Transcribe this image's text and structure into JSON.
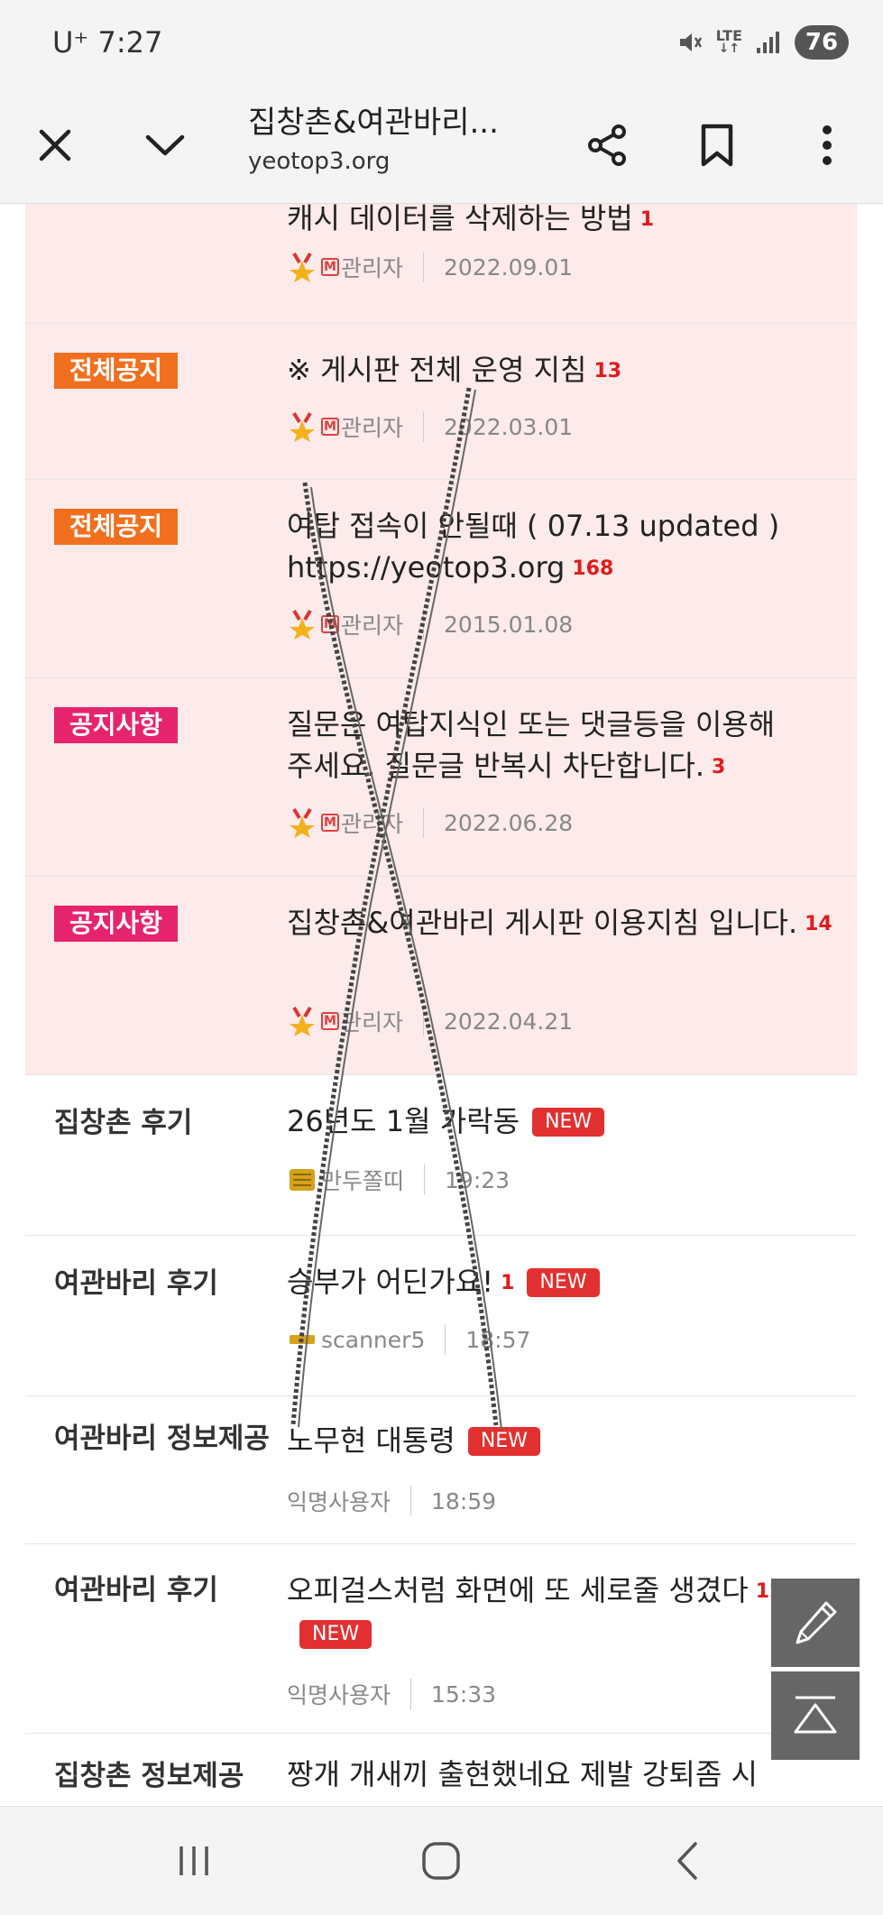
{
  "status_bar": {
    "carrier_time": "U⁺ 7:27",
    "network": "LTE",
    "battery": "76"
  },
  "toolbar": {
    "title": "집창촌&여관바리...",
    "url": "yeotop3.org"
  },
  "posts": [
    {
      "type": "notice",
      "badge": "",
      "title": "캐시 데이터를 삭제하는 방법",
      "comments": "1",
      "author": "관리자",
      "date": "2022.09.01"
    },
    {
      "type": "notice",
      "badge": "전체공지",
      "badge_color": "#f07020",
      "title": "※ 게시판 전체 운영 지침",
      "comments": "13",
      "author": "관리자",
      "date": "2022.03.01"
    },
    {
      "type": "notice",
      "badge": "전체공지",
      "badge_color": "#f07020",
      "title": "여탑 접속이 안될때 ( 07.13 updated ) https://yeotop3.org",
      "comments": "168",
      "author": "관리자",
      "date": "2015.01.08"
    },
    {
      "type": "notice",
      "badge": "공지사항",
      "badge_color": "#e6246d",
      "title": "질문은 여탑지식인 또는 댓글등을 이용해 주세요. 질문글 반복시 차단합니다.",
      "comments": "3",
      "author": "관리자",
      "date": "2022.06.28"
    },
    {
      "type": "notice",
      "badge": "공지사항",
      "badge_color": "#e6246d",
      "title": "집창촌&여관바리 게시판 이용지침 입니다.",
      "comments": "14",
      "author": "관리자",
      "date": "2022.04.21"
    },
    {
      "type": "post",
      "category": "집창촌 후기",
      "title": "26년도 1월 가락동",
      "comments": "",
      "new_label": "NEW",
      "author": "만두쫄띠",
      "time": "19:23"
    },
    {
      "type": "post",
      "category": "여관바리 후기",
      "title": "승부가 어딘가요!",
      "comments": "1",
      "new_label": "NEW",
      "author": "scanner5",
      "time": "18:57"
    },
    {
      "type": "post",
      "category": "여관바리 정보제공",
      "title": "노무현 대통령",
      "comments": "",
      "new_label": "NEW",
      "author": "익명사용자",
      "time": "18:59"
    },
    {
      "type": "post",
      "category": "여관바리 후기",
      "title": "오피걸스처럼 화면에 또 세로줄 생겼다",
      "comments": "12",
      "new_label": "NEW",
      "author": "익명사용자",
      "time": "15:33"
    },
    {
      "type": "post",
      "category": "집창촌 정보제공",
      "title": "짱개 개새끼 출현했네요 제발 강퇴좀 시",
      "comments": "",
      "new_label": "",
      "author": "",
      "time": ""
    }
  ],
  "icons": {
    "close": "close-icon",
    "chevron": "chevron-down-icon",
    "share": "share-icon",
    "bookmark": "bookmark-icon",
    "more": "more-vert-icon",
    "write": "pencil-icon",
    "top": "scroll-top-icon"
  },
  "colors": {
    "notice_bg": "#fdeaea",
    "orange_badge": "#f07020",
    "pink_badge": "#e6246d",
    "comment_count": "#e01b1b",
    "new_badge": "#e23030"
  }
}
